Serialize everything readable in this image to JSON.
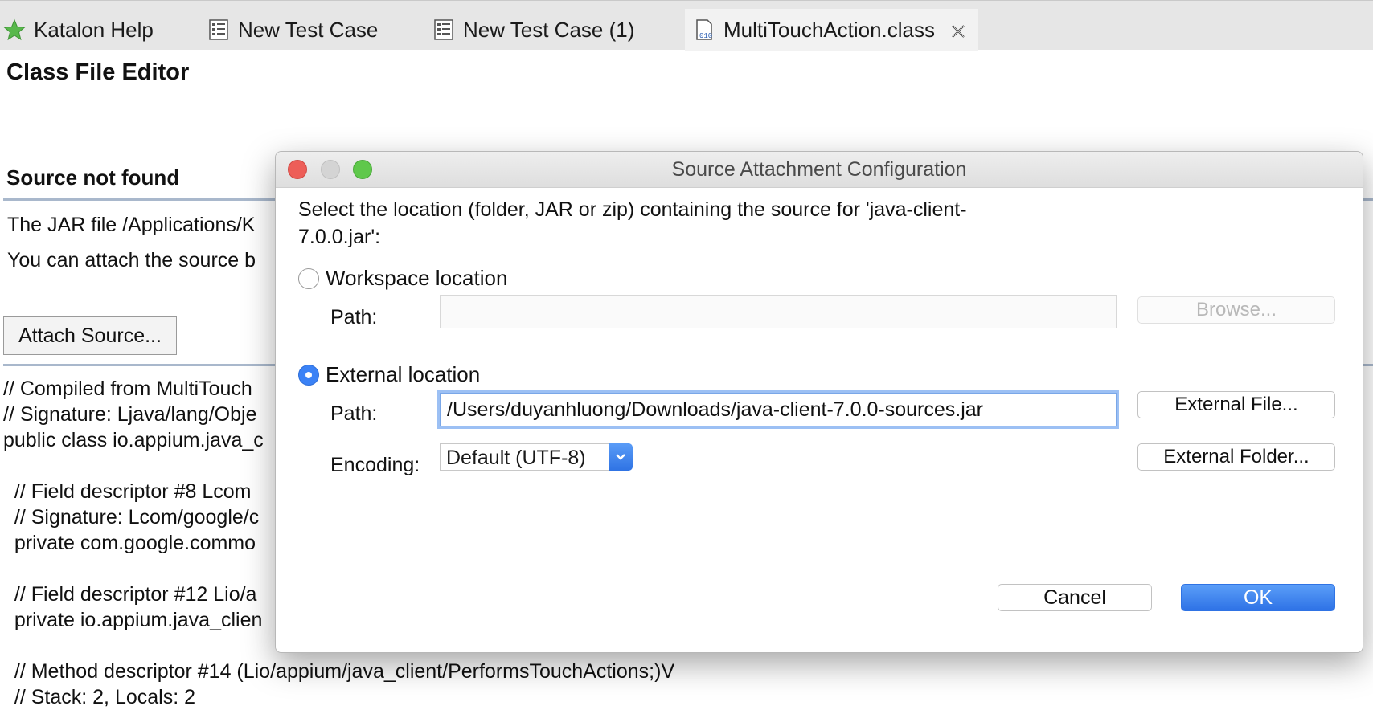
{
  "tabs": [
    {
      "label": "Katalon Help",
      "icon": "star-icon"
    },
    {
      "label": "New Test Case",
      "icon": "test-case-icon"
    },
    {
      "label": "New Test Case (1)",
      "icon": "test-case-icon"
    },
    {
      "label": "MultiTouchAction.class",
      "icon": "class-file-icon",
      "active": true
    }
  ],
  "editor": {
    "title": "Class File Editor",
    "source_title": "Source not found",
    "message_line1": "The JAR file /Applications/K",
    "message_line2": "You can attach the source b",
    "attach_button": "Attach Source...",
    "code": "// Compiled from MultiTouch\n// Signature: Ljava/lang/Obje\npublic class io.appium.java_c\n\n  // Field descriptor #8 Lcom\n  // Signature: Lcom/google/c\n  private com.google.commo\n\n  // Field descriptor #12 Lio/a\n  private io.appium.java_clien\n\n  // Method descriptor #14 (Lio/appium/java_client/PerformsTouchActions;)V\n  // Stack: 2, Locals: 2"
  },
  "dialog": {
    "title": "Source Attachment Configuration",
    "description": "Select the location (folder, JAR or zip) containing the source for 'java-client-7.0.0.jar':",
    "workspace_option": "Workspace location",
    "workspace_path_label": "Path:",
    "workspace_path_value": "",
    "browse_button": "Browse...",
    "external_option": "External location",
    "external_path_label": "Path:",
    "external_path_value": "/Users/duyanhluong/Downloads/java-client-7.0.0-sources.jar",
    "external_file_button": "External File...",
    "encoding_label": "Encoding:",
    "encoding_value": "Default (UTF-8)",
    "external_folder_button": "External Folder...",
    "cancel_button": "Cancel",
    "ok_button": "OK",
    "selected_option": "External location"
  },
  "colors": {
    "accent": "#3b82f6",
    "tabbar": "#e6e6e6",
    "rule": "#a9b8cc",
    "close_red": "#ed5e58",
    "zoom_green": "#5fc84b"
  }
}
